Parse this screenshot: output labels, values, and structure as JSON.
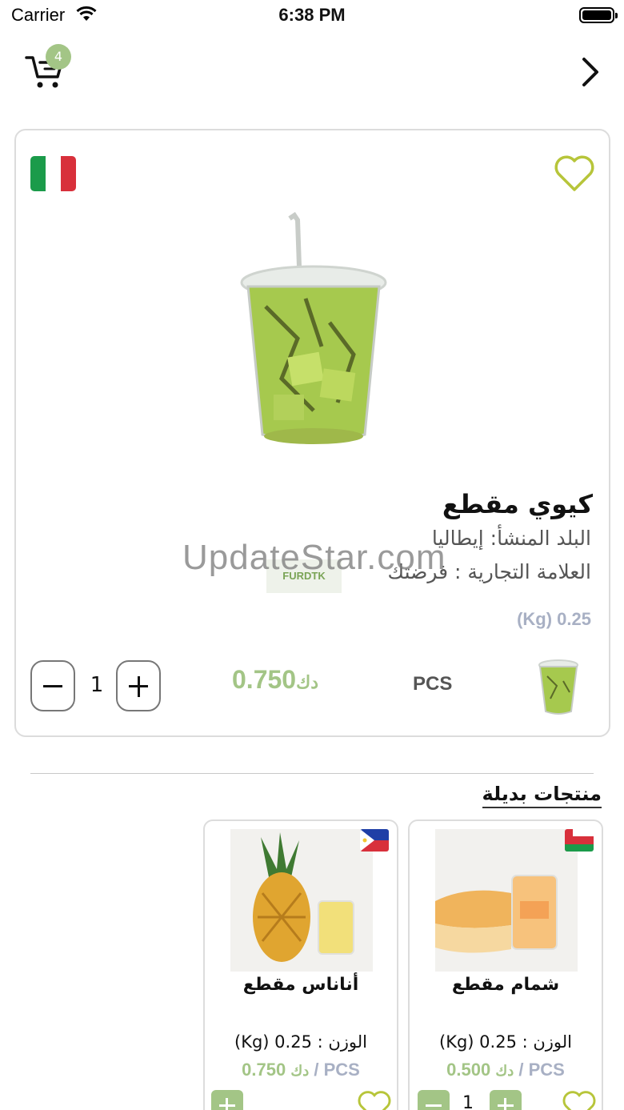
{
  "status_bar": {
    "carrier": "Carrier",
    "time": "6:38 PM"
  },
  "nav": {
    "cart_count": "4"
  },
  "product": {
    "title": "كيوي مقطع",
    "origin": "البلد المنشأ: إيطاليا",
    "brand": "العلامة التجارية : فرضتك",
    "brand_logo_text": "FURDTK",
    "weight": "(Kg) 0.25",
    "quantity": "1",
    "price": "0.750",
    "currency": "دك",
    "unit": "PCS"
  },
  "alternatives": {
    "title": "منتجات بديلة",
    "items": [
      {
        "name": "شمام مقطع",
        "weight": "الوزن : 0.25 (Kg)",
        "price": "0.500",
        "currency": "دك",
        "unit": "PCS",
        "quantity": "1"
      },
      {
        "name": "أناناس مقطع",
        "weight": "الوزن : 0.25 (Kg)",
        "price": "0.750",
        "currency": "دك",
        "unit": "PCS"
      }
    ]
  },
  "watermark": "UpdateStar.com",
  "colors": {
    "accent": "#a3c586",
    "heart": "#b7c53a",
    "muted": "#a8b0c4"
  }
}
